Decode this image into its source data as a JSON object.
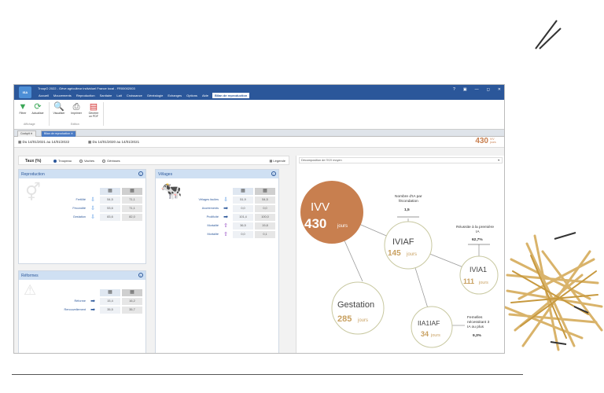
{
  "app": {
    "logo": "ISA",
    "title_line": "TroupO 2022 - Gève agriculteur individuel France local - FR00002003",
    "menus": [
      "Accueil",
      "Mouvements",
      "Reproduction",
      "Sanitaire",
      "Lait",
      "Croissance",
      "Généalogie",
      "Echanges",
      "Options",
      "Aide",
      "Bilan de reproduction"
    ],
    "window_controls": [
      "?",
      "▣",
      "—",
      "◻",
      "✕"
    ]
  },
  "ribbon": {
    "filter_label": "Filtrer",
    "refresh_label": "Actualiser",
    "group1": "Affichage",
    "preview_label": "Visualiser",
    "print_label": "Imprimer",
    "pdf_label": "Générer un PDF",
    "group2": "Edition"
  },
  "tabs": [
    "Cockpit",
    "Bilan de reproduction"
  ],
  "period": {
    "period1": "Du 14/01/2021 au 14/01/2022",
    "period2": "Du 14/01/2020 au 14/01/2021"
  },
  "header_ivv": {
    "value": "430",
    "unit": "IVV jours"
  },
  "taux": {
    "title": "Taux (%)",
    "options": [
      "Troupeau",
      "Vaches",
      "Génisses"
    ],
    "legend_label": "Légende"
  },
  "reproduction": {
    "title": "Reproduction",
    "info": "i",
    "rows": [
      {
        "label": "Fertilité",
        "arrow": "⇩",
        "arrow_color": "#4a90e2",
        "v1": "54,5",
        "v2": "71,1"
      },
      {
        "label": "Fécondité",
        "arrow": "⇩",
        "arrow_color": "#4a90e2",
        "v1": "53,6",
        "v2": "71,1"
      },
      {
        "label": "Gestation",
        "arrow": "⇩",
        "arrow_color": "#4a90e2",
        "v1": "83,6",
        "v2": "82,0"
      }
    ]
  },
  "velages": {
    "title": "Vêlages",
    "info": "i",
    "rows": [
      {
        "label": "Vêlages faciles",
        "arrow": "⇩",
        "arrow_color": "#4a90e2",
        "v1": "51,9",
        "v2": "54,5"
      },
      {
        "label": "Avortements",
        "arrow": "➡",
        "arrow_color": "#2b579a",
        "v1": "0,0",
        "v2": "0,0"
      },
      {
        "label": "Prolificité",
        "arrow": "➡",
        "arrow_color": "#2b579a",
        "v1": "101,4",
        "v2": "100,0"
      },
      {
        "label": "Mortalité",
        "arrow": "⇧",
        "arrow_color": "#8e3fbf",
        "v1": "36,5",
        "v2": "19,8"
      },
      {
        "label": "Mortalité",
        "arrow": "⇧",
        "arrow_color": "#8e3fbf",
        "v1": "0,0",
        "v2": "0,1"
      }
    ]
  },
  "reformes": {
    "title": "Réformes",
    "info": "i",
    "rows": [
      {
        "label": "Réforme",
        "arrow": "➡",
        "arrow_color": "#2b579a",
        "v1": "15,4",
        "v2": "16,2"
      },
      {
        "label": "Renouvellement",
        "arrow": "➡",
        "arrow_color": "#2b579a",
        "v1": "35,5",
        "v2": "35,7"
      }
    ]
  },
  "decomposition": {
    "dropdown": "Décomposition de l'IVV moyen",
    "ivv": {
      "label": "IVV",
      "value": "430",
      "unit": "jours"
    },
    "iviaf": {
      "label": "IVIAF",
      "value": "145",
      "unit": "jours"
    },
    "ivia1": {
      "label": "IVIA1",
      "value": "111",
      "unit": "jours"
    },
    "gestation": {
      "label": "Gestation",
      "value": "285",
      "unit": "jours"
    },
    "ia1iaf": {
      "label": "IIA1IAF",
      "value": "34",
      "unit": "jours"
    },
    "nb_ia_label": [
      "Nombre d'IA par",
      "fécondation"
    ],
    "nb_ia_value": "1,5",
    "reussite_label": [
      "Réussite à la première",
      "IA"
    ],
    "reussite_value": "62,7%",
    "femelles_label": [
      "Femelles",
      "nécessitant 3",
      "IA ou plus"
    ],
    "femelles_value": "9,3%"
  },
  "colors": {
    "accent": "#2b579a",
    "ivv": "#c87f4f",
    "gold": "#c8a060"
  }
}
